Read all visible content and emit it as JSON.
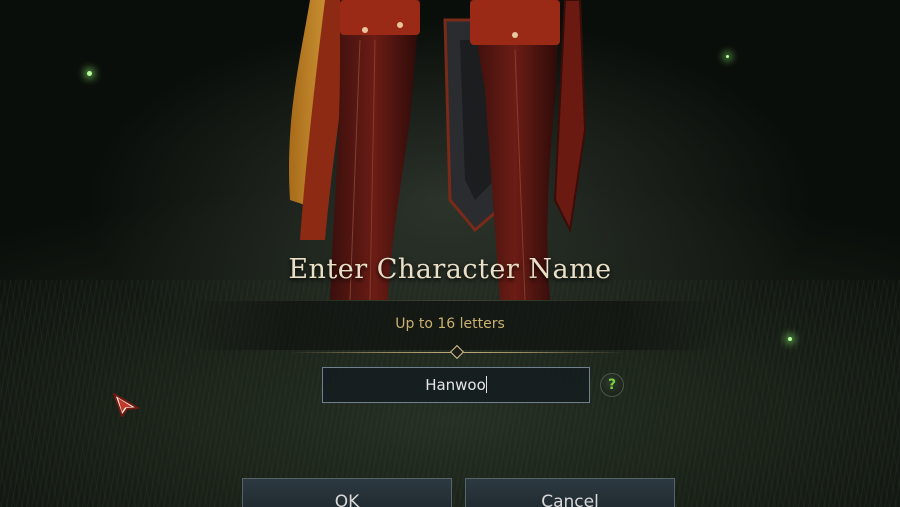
{
  "dialog": {
    "title": "Enter Character Name",
    "hint": "Up to 16 letters",
    "name_value": "Hanwoo",
    "help_glyph": "?"
  },
  "buttons": {
    "ok_label": "OK",
    "cancel_label": "Cancel"
  },
  "icons": {
    "help": "question-mark-icon",
    "cursor": "arrow-cursor-icon"
  },
  "colors": {
    "title": "#e9dfc7",
    "hint": "#c9b170",
    "help_accent": "#79d13d",
    "input_border": "#6f8190"
  }
}
